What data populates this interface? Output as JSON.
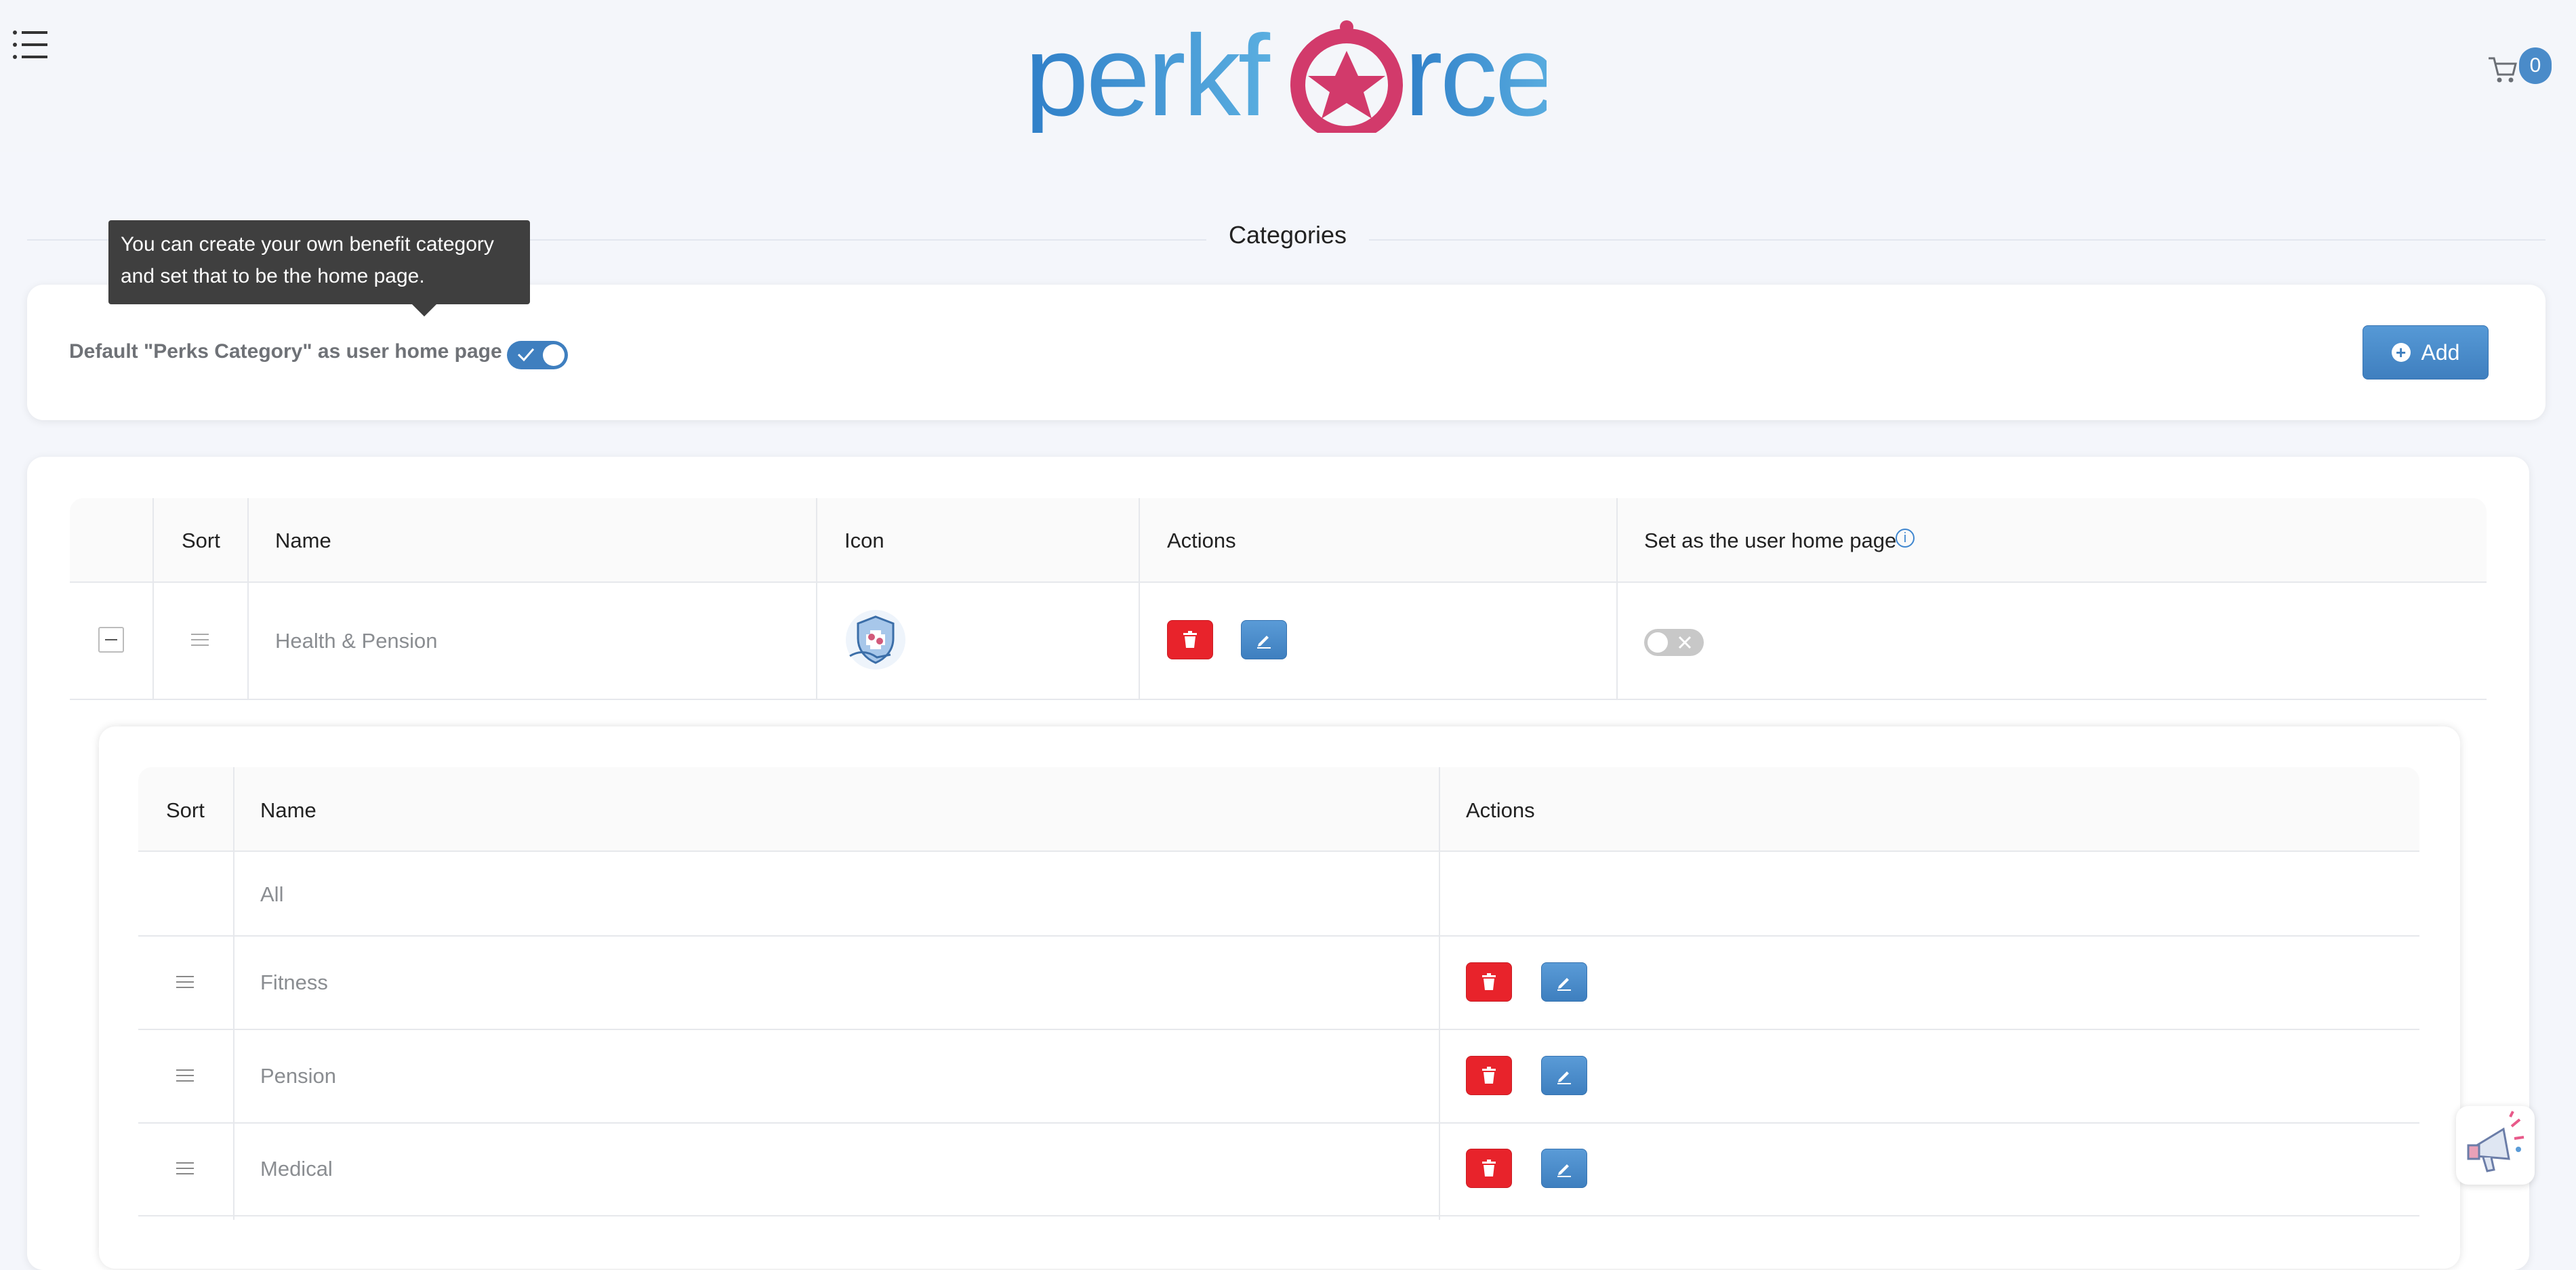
{
  "header": {
    "logo_text": "perkforce",
    "cart_count": "0"
  },
  "page": {
    "section_title": "Categories",
    "tooltip_line1": "You can create your own benefit category",
    "tooltip_line2": "and set that to be the home page.",
    "default_label": "Default \"Perks Category\" as user home page",
    "default_toggle_on": true,
    "add_label": "Add"
  },
  "categories_table": {
    "headers": {
      "sort": "Sort",
      "name": "Name",
      "icon": "Icon",
      "actions": "Actions",
      "home": "Set as the user home page"
    },
    "rows": [
      {
        "name": "Health & Pension",
        "icon": "shield-health-icon",
        "home_toggle_on": false
      }
    ]
  },
  "subcategories_table": {
    "headers": {
      "sort": "Sort",
      "name": "Name",
      "actions": "Actions"
    },
    "rows": [
      {
        "name": "All"
      },
      {
        "name": "Fitness"
      },
      {
        "name": "Pension"
      },
      {
        "name": "Medical"
      }
    ]
  },
  "colors": {
    "primary": "#3f7fbf",
    "danger": "#e8232b",
    "logo_blue": "#3b8fd0",
    "logo_pink": "#d23a6b"
  }
}
